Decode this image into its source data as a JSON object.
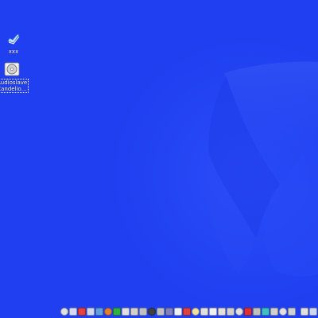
{
  "desktop": {
    "icons": [
      {
        "label": "xxx",
        "icon": "blue-folder-icon"
      },
      {
        "label_line1": "Audioslave-",
        "label_line2": "Candelio…",
        "icon": "cd-audio-icon"
      }
    ]
  },
  "taskbar": {
    "icons": [
      {
        "icon": "globe-icon",
        "color": "#e0e0e0"
      },
      {
        "icon": "mail-icon",
        "color": "#d8d8f0"
      },
      {
        "icon": "lifebuoy-icon",
        "color": "#e84040"
      },
      {
        "icon": "monitor-icon",
        "color": "#d0d8e8"
      },
      {
        "icon": "globe-blue-icon",
        "color": "#60a0e0"
      },
      {
        "icon": "mozilla-icon",
        "color": "#e08030"
      },
      {
        "icon": "chat-icon",
        "color": "#30b040"
      },
      {
        "icon": "pen-icon",
        "color": "#e0e0e0"
      },
      {
        "icon": "terminal-icon",
        "color": "#d0d0d0"
      },
      {
        "icon": "cd-icon",
        "color": "#c0c0c0"
      },
      {
        "icon": "media-icon",
        "color": "#404040"
      },
      {
        "icon": "speaker-icon",
        "color": "#c0c0c0"
      },
      {
        "icon": "network-icon",
        "color": "#8080c0"
      },
      {
        "icon": "document-icon",
        "color": "#f0f0f0"
      },
      {
        "icon": "calendar-icon",
        "color": "#e04040"
      },
      {
        "icon": "image-icon",
        "color": "#f0e0a0"
      },
      {
        "icon": "edit-icon",
        "color": "#e0e0e0"
      },
      {
        "icon": "notes-icon",
        "color": "#f0f0f0"
      },
      {
        "icon": "write-icon",
        "color": "#e0e0e0"
      },
      {
        "icon": "file-icon",
        "color": "#d0d0d0"
      },
      {
        "icon": "spreadsheet-icon",
        "color": "#e0e0e0"
      },
      {
        "icon": "close-red-icon",
        "color": "#e03030"
      },
      {
        "icon": "run-icon",
        "color": "#c0c0c0"
      },
      {
        "icon": "bookmark-icon",
        "color": "#40c0c0"
      },
      {
        "icon": "tools-icon",
        "color": "#d0d0d0"
      },
      {
        "icon": "toggle-icon",
        "color": "#e0e0e0"
      },
      {
        "icon": "power-icon",
        "color": "#d0d0d0"
      },
      {
        "icon": "pencil-icon",
        "color": "#e0e0e0"
      },
      {
        "icon": "display-icon",
        "color": "#d0d8f0"
      }
    ]
  }
}
